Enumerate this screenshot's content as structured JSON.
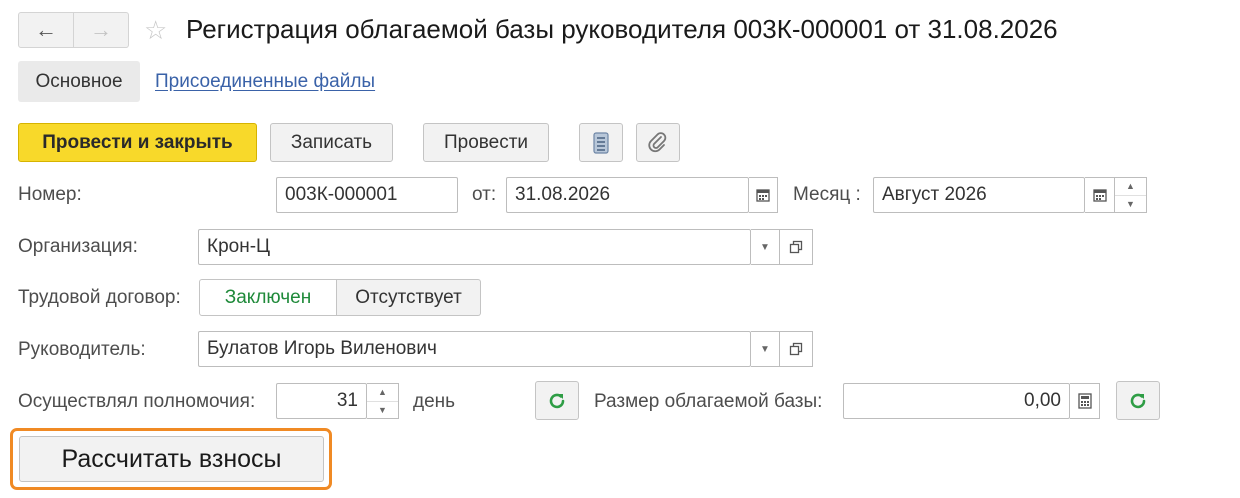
{
  "window": {
    "title": "Регистрация облагаемой базы руководителя 003К-000001 от 31.08.2026"
  },
  "nav": {
    "back_glyph": "←",
    "forward_glyph": "→",
    "favorite_glyph": "☆"
  },
  "tabs": {
    "main": "Основное",
    "files": "Присоединенные файлы"
  },
  "toolbar": {
    "post_close": "Провести и закрыть",
    "save": "Записать",
    "post": "Провести",
    "icons": [
      "document-list-icon",
      "paperclip-icon"
    ]
  },
  "form": {
    "number_label": "Номер:",
    "number_value": "003К-000001",
    "date_label": "от:",
    "date_value": "31.08.2026",
    "month_label": "Месяц :",
    "month_value": "Август 2026",
    "org_label": "Организация:",
    "org_value": "Крон-Ц",
    "contract_label": "Трудовой договор:",
    "contract_options": [
      "Заключен",
      "Отсутствует"
    ],
    "contract_selected": "Заключен",
    "manager_label": "Руководитель:",
    "manager_value": "Булатов Игорь Виленович",
    "powers_label": "Осуществлял полномочия:",
    "powers_value": "31",
    "powers_unit": "день",
    "base_label": "Размер облагаемой базы:",
    "base_value": "0,00"
  },
  "calc_button": "Рассчитать взносы",
  "colors": {
    "primary_button": "#f8d92a",
    "link": "#3a62a8",
    "selected_switch_text": "#1f8a3a",
    "highlight": "#f08a24",
    "refresh_icon": "#2e9d45"
  }
}
